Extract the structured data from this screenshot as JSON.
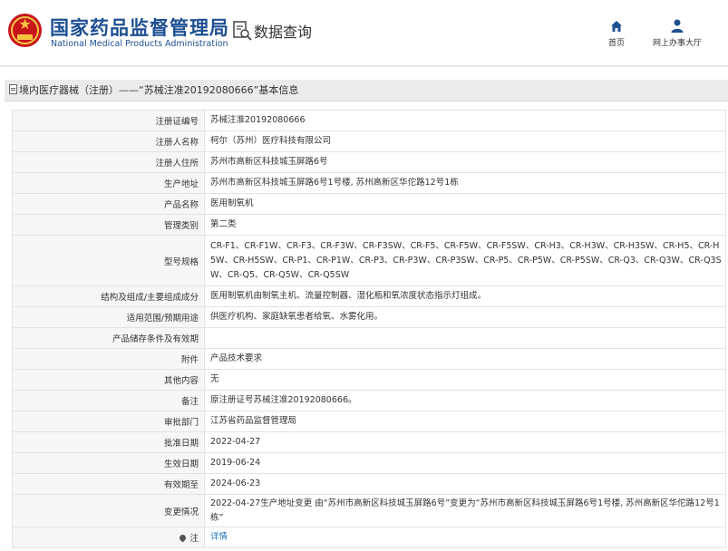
{
  "header": {
    "site_name_cn": "国家药品监督管理局",
    "site_name_en": "National Medical Products Administration",
    "logo_icon": "national-emblem-icon",
    "query_icon": "search-document-icon",
    "query_title": "数据查询",
    "nav": [
      {
        "label": "首页",
        "icon": "home-icon"
      },
      {
        "label": "网上办事大厅",
        "icon": "user-icon"
      }
    ],
    "brand_color": "#1d4f91"
  },
  "section": {
    "title": "境内医疗器械（注册）——“苏械注准20192080666”基本信息"
  },
  "details": [
    {
      "key": "注册证编号",
      "value": "苏械注准20192080666"
    },
    {
      "key": "注册人名称",
      "value": "柯尔（苏州）医疗科技有限公司"
    },
    {
      "key": "注册人住所",
      "value": "苏州市高新区科技城玉屏路6号"
    },
    {
      "key": "生产地址",
      "value": "苏州市高新区科技城玉屏路6号1号楼, 苏州高新区华佗路12号1栋"
    },
    {
      "key": "产品名称",
      "value": "医用制氧机"
    },
    {
      "key": "管理类别",
      "value": "第二类"
    },
    {
      "key": "型号规格",
      "value": "CR-F1、CR-F1W、CR-F3、CR-F3W、CR-F3SW、CR-F5、CR-F5W、CR-F5SW、CR-H3、CR-H3W、CR-H3SW、CR-H5、CR-H5W、CR-H5SW、CR-P1、CR-P1W、CR-P3、CR-P3W、CR-P3SW、CR-P5、CR-P5W、CR-P5SW、CR-Q3、CR-Q3W、CR-Q3SW、CR-Q5、CR-Q5W、CR-Q5SW"
    },
    {
      "key": "结构及组成/主要组成成分",
      "value": "医用制氧机由制氧主机、流量控制器、湿化瓶和氧浓度状态指示灯组成。"
    },
    {
      "key": "适用范围/预期用途",
      "value": "供医疗机构、家庭缺氧患者给氧、水雾化用。"
    },
    {
      "key": "产品储存条件及有效期",
      "value": ""
    },
    {
      "key": "附件",
      "value": "产品技术要求"
    },
    {
      "key": "其他内容",
      "value": "无"
    },
    {
      "key": "备注",
      "value": "原注册证号苏械注准20192080666。"
    },
    {
      "key": "审批部门",
      "value": "江苏省药品监督管理局"
    },
    {
      "key": "批准日期",
      "value": "2022-04-27"
    },
    {
      "key": "生效日期",
      "value": "2019-06-24"
    },
    {
      "key": "有效期至",
      "value": "2024-06-23"
    },
    {
      "key": "变更情况",
      "value": "2022-04-27生产地址变更 由“苏州市高新区科技城玉屏路6号”变更为“苏州市高新区科技城玉屏路6号1号楼, 苏州高新区华佗路12号1栋”"
    },
    {
      "key": "注",
      "key_icon": "map-pin-icon",
      "value": "详情"
    }
  ]
}
